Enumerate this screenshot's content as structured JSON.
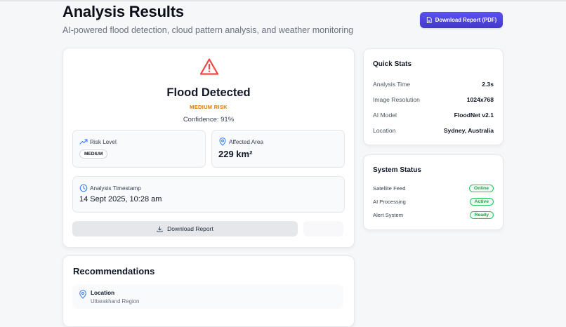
{
  "header": {
    "title": "Analysis Results",
    "subtitle": "AI-powered flood detection, cloud pattern analysis, and weather monitoring",
    "download_pdf_label": "Download Report (PDF)"
  },
  "result": {
    "title": "Flood Detected",
    "risk_label": "MEDIUM RISK",
    "confidence": "Confidence: 91%",
    "risk_level": {
      "label": "Risk Level",
      "badge": "MEDIUM"
    },
    "affected_area": {
      "label": "Affected Area",
      "value": "229 km²"
    },
    "timestamp": {
      "label": "Analysis Timestamp",
      "value": "14 Sept 2025, 10:28 am"
    },
    "download_label": "Download Report"
  },
  "quick_stats": {
    "title": "Quick Stats",
    "rows": [
      {
        "key": "Analysis Time",
        "value": "2.3s"
      },
      {
        "key": "Image Resolution",
        "value": "1024x768"
      },
      {
        "key": "AI Model",
        "value": "FloodNet v2.1"
      },
      {
        "key": "Location",
        "value": "Sydney, Australia"
      }
    ]
  },
  "system_status": {
    "title": "System Status",
    "rows": [
      {
        "key": "Satellite Feed",
        "status": "Online"
      },
      {
        "key": "AI Processing",
        "status": "Active"
      },
      {
        "key": "Alert System",
        "status": "Ready"
      }
    ]
  },
  "recommendations": {
    "title": "Recommendations",
    "items": [
      {
        "label": "Location",
        "value": "Uttarakhand Region"
      }
    ]
  },
  "colors": {
    "accent": "#4f46e5",
    "warning": "#d97706",
    "danger": "#ef4444",
    "success": "#16a34a",
    "info": "#3b82f6"
  },
  "icons": {
    "pdf_button": "file-icon",
    "result": "warning-triangle-icon",
    "risk_level": "trending-up-icon",
    "affected_area": "map-pin-icon",
    "timestamp": "clock-icon",
    "download": "download-icon",
    "recommendation_location": "map-pin-icon"
  }
}
